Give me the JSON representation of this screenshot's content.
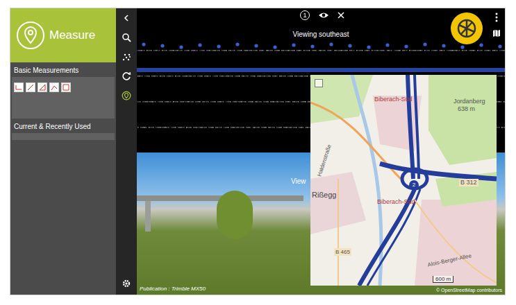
{
  "panel": {
    "title": "Measure",
    "sections": [
      {
        "label": "Basic Measurements"
      },
      {
        "label": "Current & Recently Used"
      }
    ]
  },
  "toolbar": [
    {
      "kind": "back",
      "selected": false
    },
    {
      "kind": "search",
      "selected": false
    },
    {
      "kind": "points",
      "selected": false
    },
    {
      "kind": "rotate",
      "selected": false
    },
    {
      "kind": "measure",
      "selected": true
    }
  ],
  "viewer": {
    "badge": "1",
    "heading": "Viewing southeast",
    "publication": "Publication : Trimble MX50"
  },
  "photo": {
    "label": "View"
  },
  "map": {
    "labels": [
      {
        "text": "Jordanberg",
        "kind": "place"
      },
      {
        "text": "638 m",
        "kind": "place"
      },
      {
        "text": "Biberach-Süd",
        "kind": "district"
      },
      {
        "text": "2",
        "kind": "junction"
      },
      {
        "text": "B 312",
        "kind": "road"
      },
      {
        "text": "Rißegg",
        "kind": "place"
      },
      {
        "text": "Biberach-Süd",
        "kind": "district"
      },
      {
        "text": "Haldenstraße",
        "kind": "street"
      },
      {
        "text": "B 465",
        "kind": "road"
      },
      {
        "text": "Alois-Berger-Allee",
        "kind": "street"
      }
    ],
    "scale": "600 m",
    "attribution": "© OpenStreetMap contributors"
  }
}
